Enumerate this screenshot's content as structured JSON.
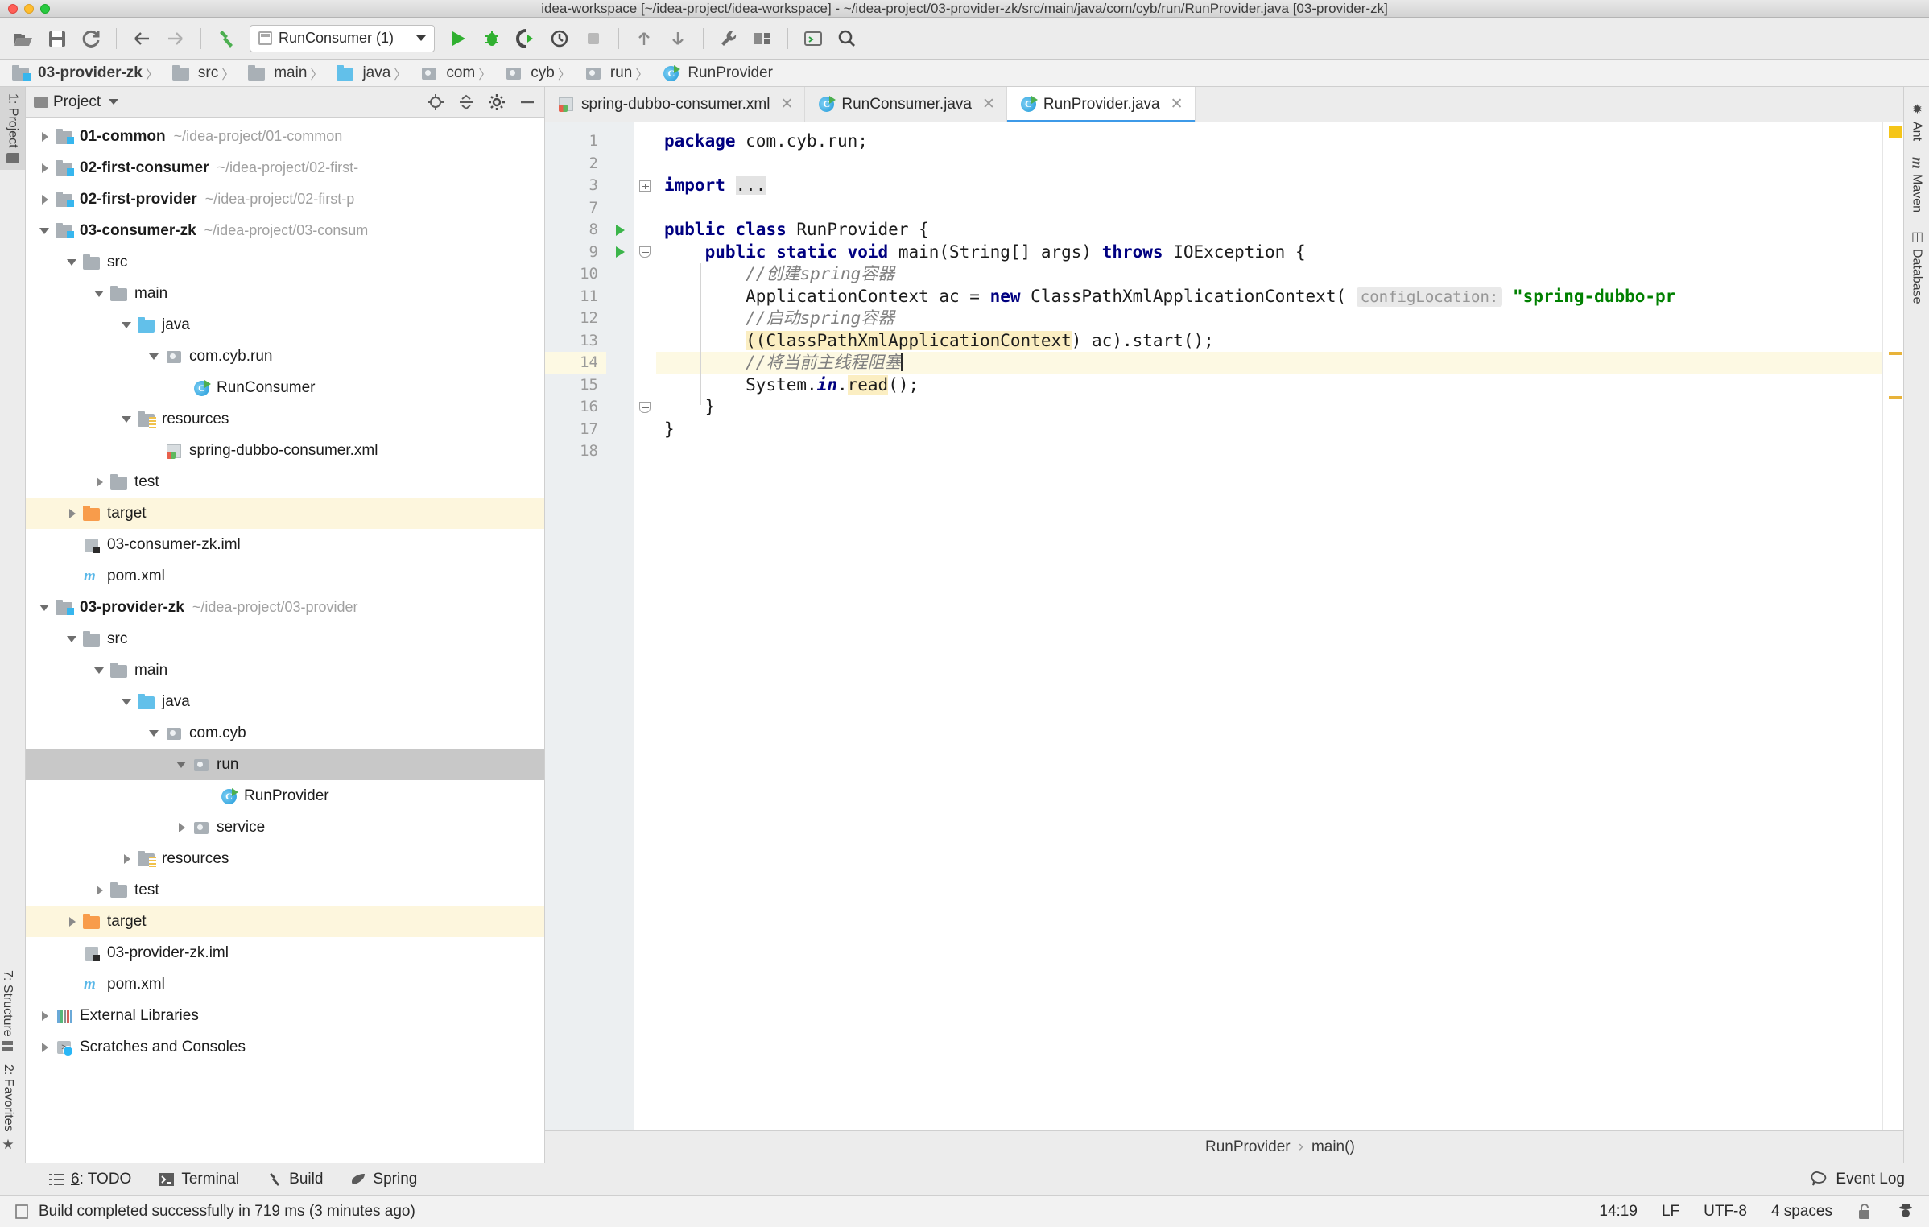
{
  "window": {
    "title": "idea-workspace [~/idea-project/idea-workspace] - ~/idea-project/03-provider-zk/src/main/java/com/cyb/run/RunProvider.java [03-provider-zk]"
  },
  "toolbar": {
    "icons": [
      {
        "name": "open-folder-icon"
      },
      {
        "name": "save-all-icon"
      },
      {
        "name": "sync-refresh-icon"
      },
      {
        "name": "navigate-back-icon"
      },
      {
        "name": "navigate-forward-icon"
      },
      {
        "name": "build-hammer-icon"
      }
    ],
    "run_config": "RunConsumer (1)",
    "right_icons": [
      {
        "name": "run-icon"
      },
      {
        "name": "debug-icon"
      },
      {
        "name": "run-coverage-icon"
      },
      {
        "name": "profile-icon"
      },
      {
        "name": "stop-icon"
      },
      {
        "name": "update-project-icon"
      },
      {
        "name": "commit-icon"
      },
      {
        "name": "settings-wrench-icon"
      },
      {
        "name": "project-structure-icon"
      },
      {
        "name": "run-anything-icon"
      },
      {
        "name": "search-everywhere-icon"
      }
    ]
  },
  "breadcrumb": {
    "items": [
      {
        "label": "03-provider-zk",
        "icon": "module-icon",
        "bold": true
      },
      {
        "label": "src",
        "icon": "folder-icon",
        "bold": false
      },
      {
        "label": "main",
        "icon": "folder-icon",
        "bold": false
      },
      {
        "label": "java",
        "icon": "source-folder-icon",
        "bold": false
      },
      {
        "label": "com",
        "icon": "package-icon",
        "bold": false
      },
      {
        "label": "cyb",
        "icon": "package-icon",
        "bold": false
      },
      {
        "label": "run",
        "icon": "package-icon",
        "bold": false
      },
      {
        "label": "RunProvider",
        "icon": "java-class-icon",
        "bold": false
      }
    ]
  },
  "left_strip": {
    "project": "1: Project",
    "structure": "7: Structure",
    "favorites": "2: Favorites"
  },
  "right_strip": {
    "items": [
      {
        "label": "Ant",
        "icon": "ant-icon"
      },
      {
        "label": "Maven",
        "icon": "maven-icon"
      },
      {
        "label": "Database",
        "icon": "database-icon"
      }
    ]
  },
  "project_panel": {
    "title": "Project",
    "tools": [
      {
        "name": "locate-target-icon"
      },
      {
        "name": "collapse-all-icon"
      },
      {
        "name": "settings-gear-icon"
      },
      {
        "name": "hide-panel-icon"
      }
    ],
    "tree": [
      {
        "label": "01-common",
        "path": "~/idea-project/01-common",
        "depth": 0,
        "arrow": "closed",
        "icon": "module-icon",
        "bold": true
      },
      {
        "label": "02-first-consumer",
        "path": "~/idea-project/02-first-",
        "depth": 0,
        "arrow": "closed",
        "icon": "module-icon",
        "bold": true
      },
      {
        "label": "02-first-provider",
        "path": "~/idea-project/02-first-p",
        "depth": 0,
        "arrow": "closed",
        "icon": "module-icon",
        "bold": true
      },
      {
        "label": "03-consumer-zk",
        "path": "~/idea-project/03-consum",
        "depth": 0,
        "arrow": "open",
        "icon": "module-icon",
        "bold": true
      },
      {
        "label": "src",
        "path": "",
        "depth": 1,
        "arrow": "open",
        "icon": "folder-icon",
        "bold": false
      },
      {
        "label": "main",
        "path": "",
        "depth": 2,
        "arrow": "open",
        "icon": "folder-icon",
        "bold": false
      },
      {
        "label": "java",
        "path": "",
        "depth": 3,
        "arrow": "open",
        "icon": "source-folder-icon",
        "bold": false
      },
      {
        "label": "com.cyb.run",
        "path": "",
        "depth": 4,
        "arrow": "open",
        "icon": "package-icon",
        "bold": false
      },
      {
        "label": "RunConsumer",
        "path": "",
        "depth": 5,
        "arrow": "none",
        "icon": "java-class-icon",
        "bold": false
      },
      {
        "label": "resources",
        "path": "",
        "depth": 3,
        "arrow": "open",
        "icon": "resources-folder-icon",
        "bold": false
      },
      {
        "label": "spring-dubbo-consumer.xml",
        "path": "",
        "depth": 4,
        "arrow": "none",
        "icon": "xml-file-icon",
        "bold": false
      },
      {
        "label": "test",
        "path": "",
        "depth": 2,
        "arrow": "closed",
        "icon": "folder-icon",
        "bold": false
      },
      {
        "label": "target",
        "path": "",
        "depth": 1,
        "arrow": "closed",
        "icon": "excluded-folder-icon",
        "bold": false,
        "highlight": "target"
      },
      {
        "label": "03-consumer-zk.iml",
        "path": "",
        "depth": 1,
        "arrow": "none",
        "icon": "iml-file-icon",
        "bold": false
      },
      {
        "label": "pom.xml",
        "path": "",
        "depth": 1,
        "arrow": "none",
        "icon": "maven-file-icon",
        "bold": false
      },
      {
        "label": "03-provider-zk",
        "path": "~/idea-project/03-provider",
        "depth": 0,
        "arrow": "open",
        "icon": "module-icon",
        "bold": true
      },
      {
        "label": "src",
        "path": "",
        "depth": 1,
        "arrow": "open",
        "icon": "folder-icon",
        "bold": false
      },
      {
        "label": "main",
        "path": "",
        "depth": 2,
        "arrow": "open",
        "icon": "folder-icon",
        "bold": false
      },
      {
        "label": "java",
        "path": "",
        "depth": 3,
        "arrow": "open",
        "icon": "source-folder-icon",
        "bold": false
      },
      {
        "label": "com.cyb",
        "path": "",
        "depth": 4,
        "arrow": "open",
        "icon": "package-icon",
        "bold": false
      },
      {
        "label": "run",
        "path": "",
        "depth": 5,
        "arrow": "open",
        "icon": "package-icon",
        "bold": false,
        "highlight": "selected"
      },
      {
        "label": "RunProvider",
        "path": "",
        "depth": 6,
        "arrow": "none",
        "icon": "java-class-icon",
        "bold": false
      },
      {
        "label": "service",
        "path": "",
        "depth": 5,
        "arrow": "closed",
        "icon": "package-icon",
        "bold": false
      },
      {
        "label": "resources",
        "path": "",
        "depth": 3,
        "arrow": "closed",
        "icon": "resources-folder-icon",
        "bold": false
      },
      {
        "label": "test",
        "path": "",
        "depth": 2,
        "arrow": "closed",
        "icon": "folder-icon",
        "bold": false
      },
      {
        "label": "target",
        "path": "",
        "depth": 1,
        "arrow": "closed",
        "icon": "excluded-folder-icon",
        "bold": false,
        "highlight": "target"
      },
      {
        "label": "03-provider-zk.iml",
        "path": "",
        "depth": 1,
        "arrow": "none",
        "icon": "iml-file-icon",
        "bold": false
      },
      {
        "label": "pom.xml",
        "path": "",
        "depth": 1,
        "arrow": "none",
        "icon": "maven-file-icon",
        "bold": false
      },
      {
        "label": "External Libraries",
        "path": "",
        "depth": 0,
        "arrow": "closed",
        "icon": "libraries-icon",
        "bold": false
      },
      {
        "label": "Scratches and Consoles",
        "path": "",
        "depth": 0,
        "arrow": "closed",
        "icon": "scratches-icon",
        "bold": false
      }
    ]
  },
  "editor": {
    "tabs": [
      {
        "label": "spring-dubbo-consumer.xml",
        "icon": "xml-file-icon",
        "active": false
      },
      {
        "label": "RunConsumer.java",
        "icon": "java-class-icon",
        "active": false
      },
      {
        "label": "RunProvider.java",
        "icon": "java-class-icon",
        "active": true
      }
    ],
    "line_numbers": [
      "1",
      "2",
      "3",
      "7",
      "8",
      "9",
      "10",
      "11",
      "12",
      "13",
      "14",
      "15",
      "16",
      "17",
      "18"
    ],
    "current_line": "14",
    "caret_position_label": "14:19",
    "code_lines": [
      {
        "num": "1",
        "text": "package com.cyb.run;"
      },
      {
        "num": "2",
        "text": ""
      },
      {
        "num": "3",
        "text": "import ..."
      },
      {
        "num": "7",
        "text": ""
      },
      {
        "num": "8",
        "text": "public class RunProvider {"
      },
      {
        "num": "9",
        "text": "    public static void main(String[] args) throws IOException {"
      },
      {
        "num": "10",
        "text": "        //创建spring容器"
      },
      {
        "num": "11",
        "text": "        ApplicationContext ac = new ClassPathXmlApplicationContext( configLocation: \"spring-dubbo-pr"
      },
      {
        "num": "12",
        "text": "        //启动spring容器"
      },
      {
        "num": "13",
        "text": "        ((ClassPathXmlApplicationContext) ac).start();"
      },
      {
        "num": "14",
        "text": "        //将当前主线程阻塞"
      },
      {
        "num": "15",
        "text": "        System.in.read();"
      },
      {
        "num": "16",
        "text": "    }"
      },
      {
        "num": "17",
        "text": "}"
      },
      {
        "num": "18",
        "text": ""
      }
    ],
    "tokens": {
      "kw_package": "package",
      "pkg_name": " com.cyb.run;",
      "kw_import": "import",
      "fold_ellipsis": "...",
      "kw_public": "public",
      "kw_class": "class",
      "class_name": "RunProvider {",
      "kw_static": "static",
      "kw_void": "void",
      "main_sig": "main(String[] args) ",
      "kw_throws": "throws",
      "exception_name": " IOException {",
      "comment_10": "//创建spring容器",
      "line11_a": "ApplicationContext ac = ",
      "kw_new": "new",
      "line11_b": " ClassPathXmlApplicationContext(",
      "param_hint": "configLocation:",
      "line11_str": "\"spring-dubbo-pr",
      "comment_12": "//启动spring容器",
      "line13_a": "((",
      "line13_occ": "ClassPathXmlApplicationContext",
      "line13_b": ") ac).start();",
      "comment_14": "//将当前主线程阻塞",
      "line15_a": "System.",
      "line15_in": "in",
      "line15_b": ".",
      "line15_read": "read",
      "line15_c": "();",
      "line16": "}",
      "line17": "}"
    },
    "crumb": {
      "class": "RunProvider",
      "method": "main()"
    }
  },
  "bottom_toolwindows": [
    {
      "label_prefix": "6",
      "label": ": TODO",
      "icon": "todo-icon"
    },
    {
      "label_prefix": "",
      "label": "Terminal",
      "icon": "terminal-icon"
    },
    {
      "label_prefix": "",
      "label": "Build",
      "icon": "build-icon"
    },
    {
      "label_prefix": "",
      "label": "Spring",
      "icon": "spring-icon"
    }
  ],
  "event_log": "Event Log",
  "statusbar": {
    "message": "Build completed successfully in 719 ms (3 minutes ago)",
    "caret": "14:19",
    "line_sep": "LF",
    "encoding": "UTF-8",
    "indent": "4 spaces",
    "lock_icon": "unlocked-icon",
    "inspector_icon": "hector-icon"
  },
  "colors": {
    "accent": "#3d9ae8",
    "keyword": "#000080",
    "string": "#008000",
    "comment": "#808080",
    "run_green": "#3bb54a",
    "target_highlight": "#fdf6dd",
    "current_line": "#fdf9e3"
  }
}
